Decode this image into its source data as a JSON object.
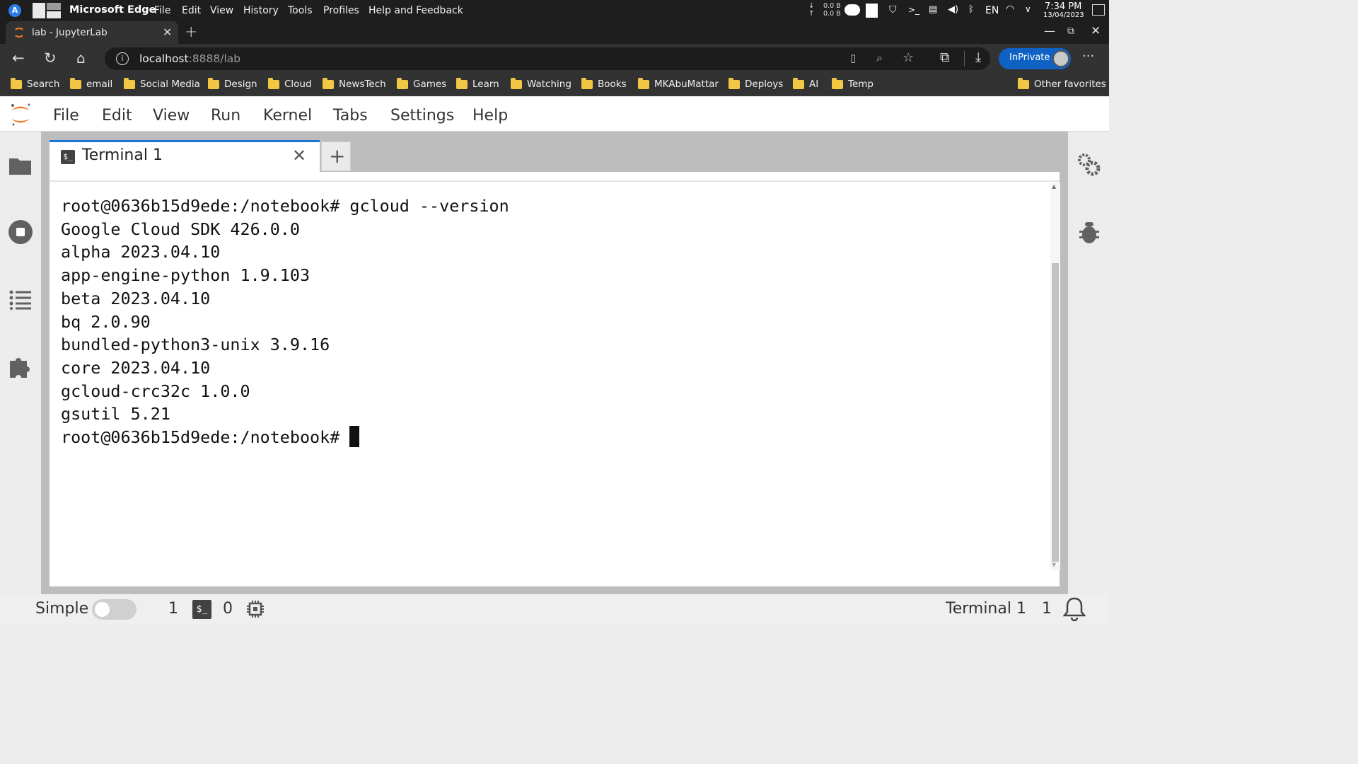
{
  "os_bar": {
    "app_name": "Microsoft Edge",
    "menu": [
      "File",
      "Edit",
      "View",
      "History",
      "Tools",
      "Profiles",
      "Help and Feedback"
    ],
    "net_down": "0.0 B",
    "net_up": "0.0 B",
    "language": "EN",
    "time": "7:34 PM",
    "date": "13/04/2023"
  },
  "browser": {
    "tab_title": "lab - JupyterLab",
    "url_host": "localhost",
    "url_path": ":8888/lab",
    "inprivate_label": "InPrivate",
    "favorites": [
      "Search",
      "email",
      "Social Media",
      "Design",
      "Cloud",
      "NewsTech",
      "Games",
      "Learn",
      "Watching",
      "Books",
      "MKAbuMattar",
      "Deploys",
      "AI",
      "Temp"
    ],
    "other_favorites": "Other favorites"
  },
  "jupyter": {
    "menu": [
      "File",
      "Edit",
      "View",
      "Run",
      "Kernel",
      "Tabs",
      "Settings",
      "Help"
    ],
    "tab_label": "Terminal 1",
    "terminal_lines": [
      "root@0636b15d9ede:/notebook# gcloud --version",
      "Google Cloud SDK 426.0.0",
      "alpha 2023.04.10",
      "app-engine-python 1.9.103",
      "beta 2023.04.10",
      "bq 2.0.90",
      "bundled-python3-unix 3.9.16",
      "core 2023.04.10",
      "gcloud-crc32c 1.0.0",
      "gsutil 5.21",
      "root@0636b15d9ede:/notebook# "
    ],
    "status": {
      "mode_label": "Simple",
      "terminals_count": "1",
      "kernels_count": "0",
      "active_label": "Terminal 1",
      "notifications_count": "1"
    }
  },
  "colors": {
    "accent": "#1976d2",
    "jupyter_orange": "#f37726",
    "inprivate_blue": "#0f62c3"
  }
}
